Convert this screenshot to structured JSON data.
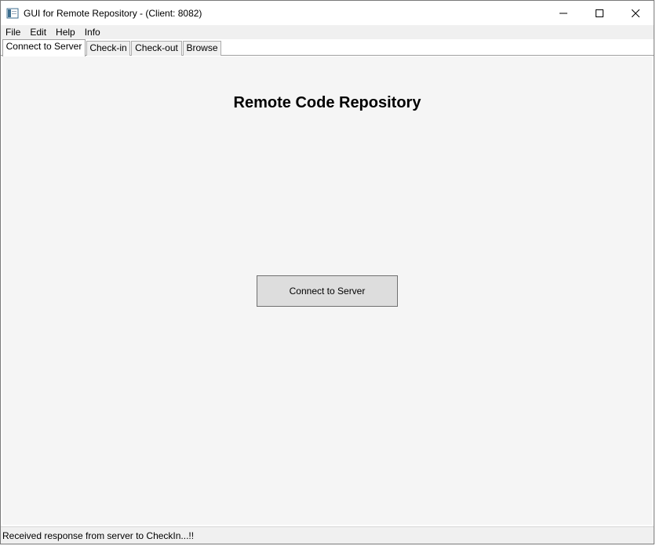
{
  "window": {
    "title": "GUI for Remote Repository - (Client: 8082)",
    "controls": {
      "minimize_icon": "minimize-icon",
      "maximize_icon": "maximize-icon",
      "close_icon": "close-icon"
    }
  },
  "menu": {
    "items": [
      "File",
      "Edit",
      "Help",
      "Info"
    ]
  },
  "tabs": [
    {
      "label": "Connect to Server",
      "active": true
    },
    {
      "label": "Check-in",
      "active": false
    },
    {
      "label": "Check-out",
      "active": false
    },
    {
      "label": "Browse",
      "active": false
    }
  ],
  "main": {
    "title": "Remote Code Repository",
    "connect_button_label": "Connect to Server"
  },
  "status": {
    "message": "Received response from server to CheckIn...!!"
  },
  "colors": {
    "content_bg": "#f5f5f5",
    "button_bg": "#dddddd",
    "menubar_bg": "#f0f0f0"
  }
}
